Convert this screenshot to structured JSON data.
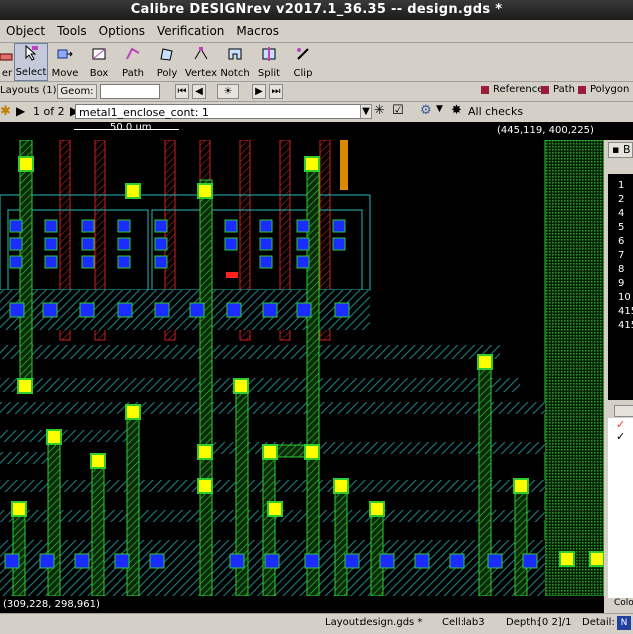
{
  "window": {
    "title": "Calibre DESIGNrev v2017.1_36.35  --  design.gds *"
  },
  "menu": [
    "Object",
    "Tools",
    "Options",
    "Verification",
    "Macros"
  ],
  "toolbar": {
    "tools": [
      {
        "label": "er",
        "icon": "eraser-icon"
      },
      {
        "label": "Select",
        "icon": "select-arrow-icon",
        "active": true
      },
      {
        "label": "Move",
        "icon": "move-icon"
      },
      {
        "label": "Box",
        "icon": "box-icon"
      },
      {
        "label": "Path",
        "icon": "path-icon"
      },
      {
        "label": "Poly",
        "icon": "poly-icon"
      },
      {
        "label": "Vertex",
        "icon": "vertex-icon"
      },
      {
        "label": "Notch",
        "icon": "notch-icon"
      },
      {
        "label": "Split",
        "icon": "split-icon"
      },
      {
        "label": "Clip",
        "icon": "clip-icon"
      }
    ],
    "legend": [
      "Reference",
      "Path",
      "Polygon"
    ]
  },
  "toolbar2": {
    "layouts_label": "Layouts (1)",
    "geom_label": "Geom:"
  },
  "toolbar3": {
    "page_count": "1 of 2",
    "check_name": "metal1_enclose_cont: 1",
    "filter": "All checks"
  },
  "ruler": {
    "scale_label": "50.0 um",
    "coords": "(445,119, 400,225)"
  },
  "canvas": {
    "cursor_coords": "(309,228, 298,961)"
  },
  "rightpanel": {
    "header": "B",
    "rows": [
      "1",
      "2",
      "4",
      "5",
      "6",
      "7",
      "8",
      "9",
      "10",
      "415",
      "415"
    ],
    "marks": [
      "red-check",
      "black-check"
    ],
    "footer": "Colo"
  },
  "status": {
    "layout_label": "Layout:",
    "layout_value": "design.gds *",
    "cell_label": "Cell:",
    "cell_value": "lab3",
    "depth_label": "Depth:",
    "depth_value": "[0 2]/1",
    "detail_label": "Detail:"
  },
  "colors": {
    "metal1": "#1f7a7f",
    "metal2": "#2ecc2e",
    "poly": "#cc2222",
    "contact": "#1a2cff",
    "via": "#ffff00",
    "background": "#000000"
  }
}
